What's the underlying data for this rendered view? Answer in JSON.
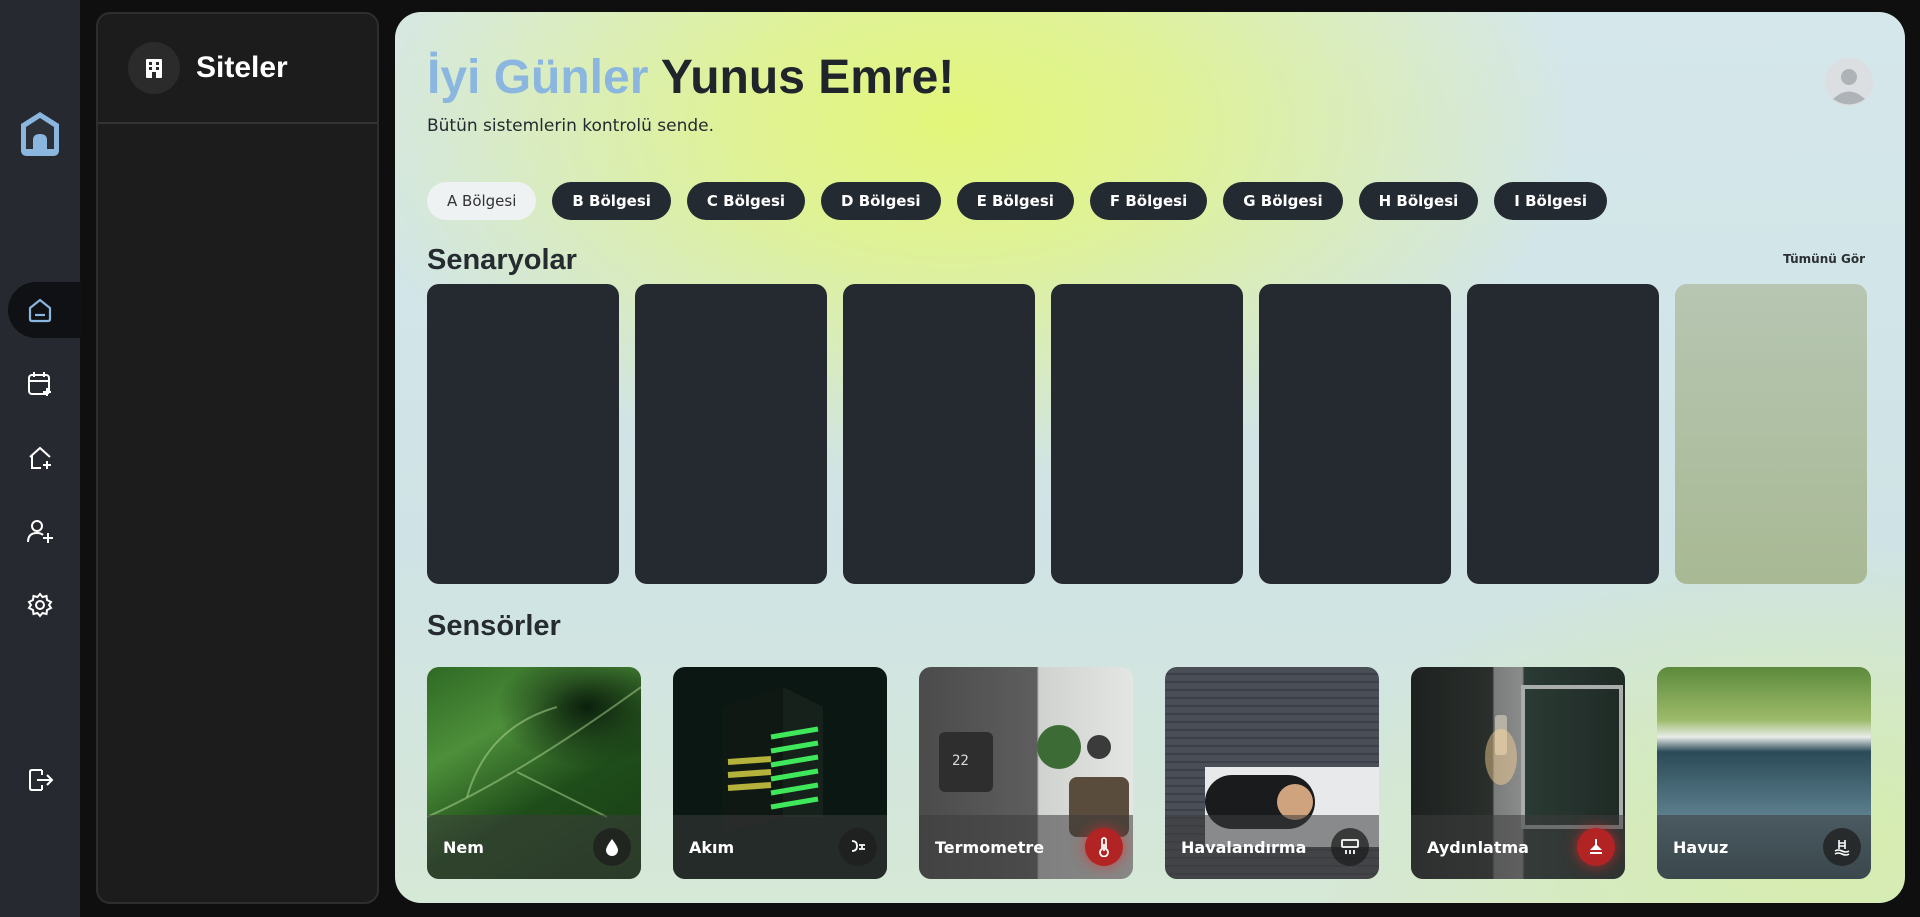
{
  "rail": {
    "items": [
      "home-icon",
      "calendar-add-icon",
      "home-add-icon",
      "user-add-icon",
      "gear-icon",
      "logout-icon"
    ]
  },
  "sites": {
    "title": "Siteler"
  },
  "header": {
    "greeting": "İyi Günler",
    "user_name": "Yunus Emre!",
    "subtitle": "Bütün sistemlerin kontrolü sende."
  },
  "regions": [
    "A Bölgesi",
    "B Bölgesi",
    "C Bölgesi",
    "D Bölgesi",
    "E Bölgesi",
    "F Bölgesi",
    "G Bölgesi",
    "H Bölgesi",
    "I Bölgesi"
  ],
  "active_region": "A Bölgesi",
  "scenarios": {
    "title": "Senaryolar",
    "see_all": "Tümünü Gör",
    "card_count": 7
  },
  "sensors": {
    "title": "Sensörler",
    "items": [
      {
        "label": "Nem",
        "icon": "water-drop-icon"
      },
      {
        "label": "Akım",
        "icon": "plug-icon"
      },
      {
        "label": "Termometre",
        "icon": "thermometer-icon"
      },
      {
        "label": "Havalandırma",
        "icon": "air-conditioner-icon"
      },
      {
        "label": "Aydınlatma",
        "icon": "ceiling-lamp-icon"
      },
      {
        "label": "Havuz",
        "icon": "pool-icon"
      }
    ]
  },
  "colors": {
    "accent": "#8ab6e0",
    "dark_card": "#252a31",
    "alert": "#b22424"
  }
}
